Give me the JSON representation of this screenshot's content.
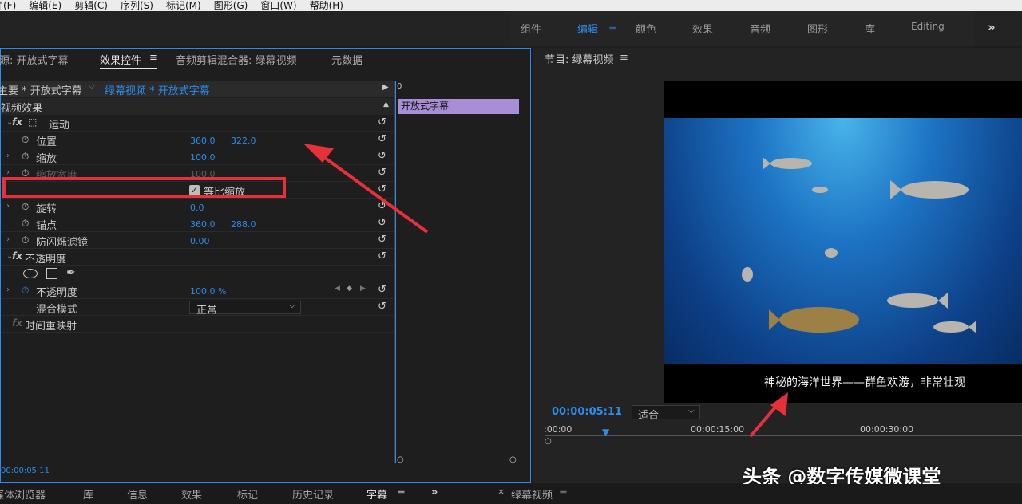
{
  "menubar": {
    "items": [
      "件(F)",
      "编辑(E)",
      "剪辑(C)",
      "序列(S)",
      "标记(M)",
      "图形(G)",
      "窗口(W)",
      "帮助(H)"
    ]
  },
  "workspace": {
    "tabs": [
      "组件",
      "编辑",
      "颜色",
      "效果",
      "音频",
      "图形",
      "库",
      "Editing"
    ],
    "active": "编辑",
    "menu_icon": "≡",
    "more": "»"
  },
  "effect_controls": {
    "tabs": [
      "源: 开放式字幕",
      "效果控件",
      "音频剪辑混合器: 绿幕视频",
      "元数据"
    ],
    "active_tab": "效果控件",
    "menu_icon": "≡",
    "clip_path_master": "主要 * 开放式字幕",
    "clip_path_sequence": "绿幕视频 * 开放式字幕",
    "timecode_start": "0",
    "clip_bar_label": "开放式字幕",
    "section_video": "视频效果",
    "motion": {
      "label": "运动",
      "position": {
        "label": "位置",
        "x": "360.0",
        "y": "322.0"
      },
      "scale": {
        "label": "缩放",
        "value": "100.0"
      },
      "scale_width": {
        "label": "缩放宽度",
        "value": "100.0"
      },
      "uniform_scale": {
        "label": "等比缩放",
        "checked": true
      },
      "rotation": {
        "label": "旋转",
        "value": "0.0"
      },
      "anchor": {
        "label": "锚点",
        "x": "360.0",
        "y": "288.0"
      },
      "anti_flicker": {
        "label": "防闪烁滤镜",
        "value": "0.00"
      }
    },
    "opacity": {
      "label": "不透明度",
      "opacity_prop": {
        "label": "不透明度",
        "value": "100.0 %"
      },
      "blend": {
        "label": "混合模式",
        "value": "正常"
      }
    },
    "time_remap": "时间重映射",
    "bottom_timecode": "00:00:05:11"
  },
  "program": {
    "title": "节目: 绿幕视频",
    "menu_icon": "≡",
    "timecode": "00:00:05:11",
    "fit": "适合",
    "ruler": [
      ":00:00",
      "00:00:15:00",
      "00:00:30:00"
    ],
    "subtitle": "神秘的海洋世界——群鱼欢游，非常壮观",
    "watermark": "头条 @数字传媒微课堂"
  },
  "bottombar": {
    "tabs": [
      "媒体浏览器",
      "库",
      "信息",
      "效果",
      "标记",
      "历史记录",
      "字幕"
    ],
    "active": "字幕",
    "menu_icon": "≡",
    "more": "»",
    "seq_tab": "绿幕视频",
    "close": "×"
  },
  "colors": {
    "accent": "#2d8ceb",
    "highlight_box": "#e5323a",
    "clip_bar": "#a88ed6"
  }
}
